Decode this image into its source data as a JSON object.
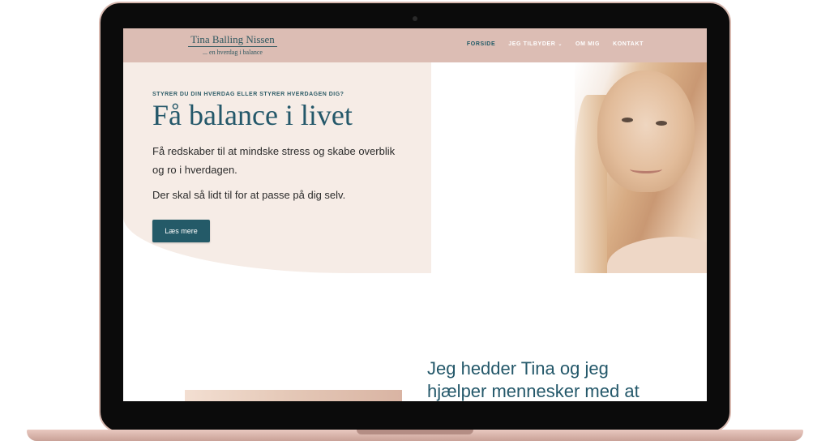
{
  "header": {
    "logo_name": "Tina Balling Nissen",
    "logo_tagline": "... en hverdag i balance",
    "nav": [
      {
        "label": "FORSIDE",
        "active": true
      },
      {
        "label": "JEG TILBYDER",
        "dropdown": true
      },
      {
        "label": "OM MIG"
      },
      {
        "label": "KONTAKT"
      }
    ]
  },
  "hero": {
    "eyebrow": "STYRER DU DIN HVERDAG ELLER STYRER HVERDAGEN DIG?",
    "title": "Få balance i livet",
    "lead": "Få redskaber til at mindske stress og skabe overblik og ro i hverdagen.",
    "lead2": "Der skal så lidt til for at passe på dig selv.",
    "cta": "Læs mere"
  },
  "intro": {
    "heading": "Jeg hedder Tina og jeg hjælper mennesker med at"
  },
  "icons": {
    "dropdown": "chevron-down-icon"
  },
  "colors": {
    "header_bg": "#dcbdb4",
    "hero_bg": "#f6ece6",
    "accent": "#24586a",
    "laptop": "#d8b9b0"
  }
}
